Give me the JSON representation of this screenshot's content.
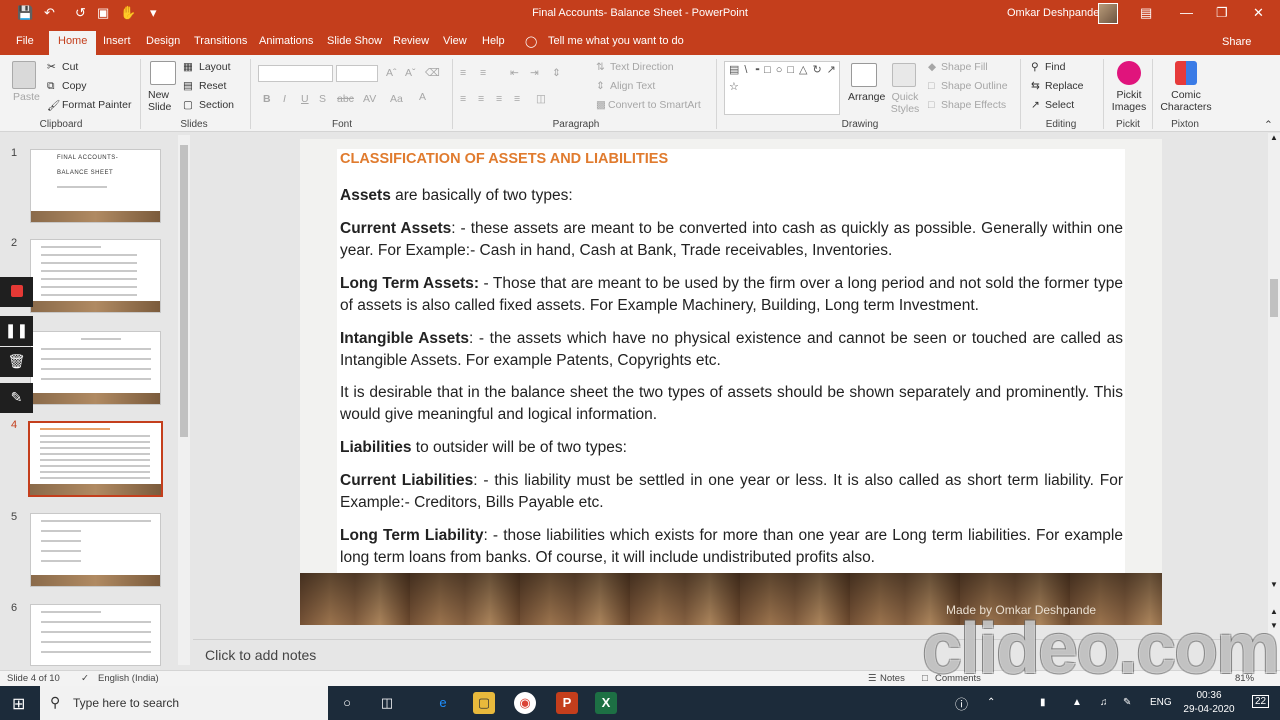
{
  "window": {
    "title": "Final Accounts- Balance Sheet  -  PowerPoint",
    "user": "Omkar Deshpande"
  },
  "tabs": [
    "File",
    "Home",
    "Insert",
    "Design",
    "Transitions",
    "Animations",
    "Slide Show",
    "Review",
    "View",
    "Help"
  ],
  "tell_me": "Tell me what you want to do",
  "share": "Share",
  "ribbon": {
    "clipboard": {
      "label": "Clipboard",
      "paste": "Paste",
      "cut": "Cut",
      "copy": "Copy",
      "format_painter": "Format Painter"
    },
    "slides": {
      "label": "Slides",
      "new_slide": "New Slide",
      "layout": "Layout",
      "reset": "Reset",
      "section": "Section"
    },
    "font": {
      "label": "Font"
    },
    "paragraph": {
      "label": "Paragraph",
      "text_direction": "Text Direction",
      "align_text": "Align Text",
      "convert_smartart": "Convert to SmartArt"
    },
    "drawing": {
      "label": "Drawing",
      "arrange": "Arrange",
      "quick_styles": "Quick Styles",
      "shape_fill": "Shape Fill",
      "shape_outline": "Shape Outline",
      "shape_effects": "Shape Effects"
    },
    "editing": {
      "label": "Editing",
      "find": "Find",
      "replace": "Replace",
      "select": "Select"
    },
    "pickit": {
      "label": "Pickit",
      "button": "Pickit Images"
    },
    "pixton": {
      "label": "Pixton",
      "button": "Comic Characters"
    }
  },
  "thumbnails": [
    {
      "num": "1",
      "title1": "FINAL ACCOUNTS-",
      "title2": "BALANCE SHEET"
    },
    {
      "num": "2"
    },
    {
      "num": "3"
    },
    {
      "num": "4"
    },
    {
      "num": "5"
    },
    {
      "num": "6"
    }
  ],
  "slide": {
    "title": "CLASSIFICATION OF ASSETS AND LIABILITIES",
    "p1_bold": "Assets",
    "p1_rest": " are basically of two types:",
    "p2_bold": "Current Assets",
    "p2_rest": ": - these assets are meant to be converted into cash as quickly as possible. Generally within one year. For Example:- Cash in hand, Cash at Bank, Trade receivables, Inventories.",
    "p3_bold": "Long Term Assets:",
    "p3_rest": " - Those that are meant to be used by the firm over a long period and not sold the former type of assets is also called fixed assets. For Example Machinery, Building, Long term Investment.",
    "p4_bold": "Intangible Assets",
    "p4_rest": ": - the assets which have no physical existence and cannot be seen or touched are called as Intangible Assets. For example Patents, Copyrights etc.",
    "p5": "It is desirable that in the balance sheet the two types of assets should be shown separately and prominently. This would give meaningful and logical information.",
    "p6_bold": "Liabilities",
    "p6_rest": " to outsider will be of two types:",
    "p7_bold": "Current Liabilities",
    "p7_rest": ": - this liability must be settled in one year or less. It is also called as short term liability. For Example:-  Creditors, Bills Payable etc.",
    "p8_bold": "Long Term Liability",
    "p8_rest": ": - those liabilities which exists for more than one year are Long term liabilities. For example long term loans from banks. Of course, it will include undistributed profits also.",
    "credit": "Made by Omkar Deshpande"
  },
  "notes_placeholder": "Click to add notes",
  "status": {
    "slide_of": "Slide 4 of 10",
    "language": "English (India)",
    "notes": "Notes",
    "comments": "Comments",
    "zoom": "81%"
  },
  "watermark": "clideo.com",
  "taskbar": {
    "search_placeholder": "Type here to search",
    "lang": "ENG",
    "time": "00:36",
    "date": "29-04-2020",
    "notif_count": "22"
  },
  "colors": {
    "accent": "#c43e1c",
    "slide_title": "#e07b2e"
  }
}
